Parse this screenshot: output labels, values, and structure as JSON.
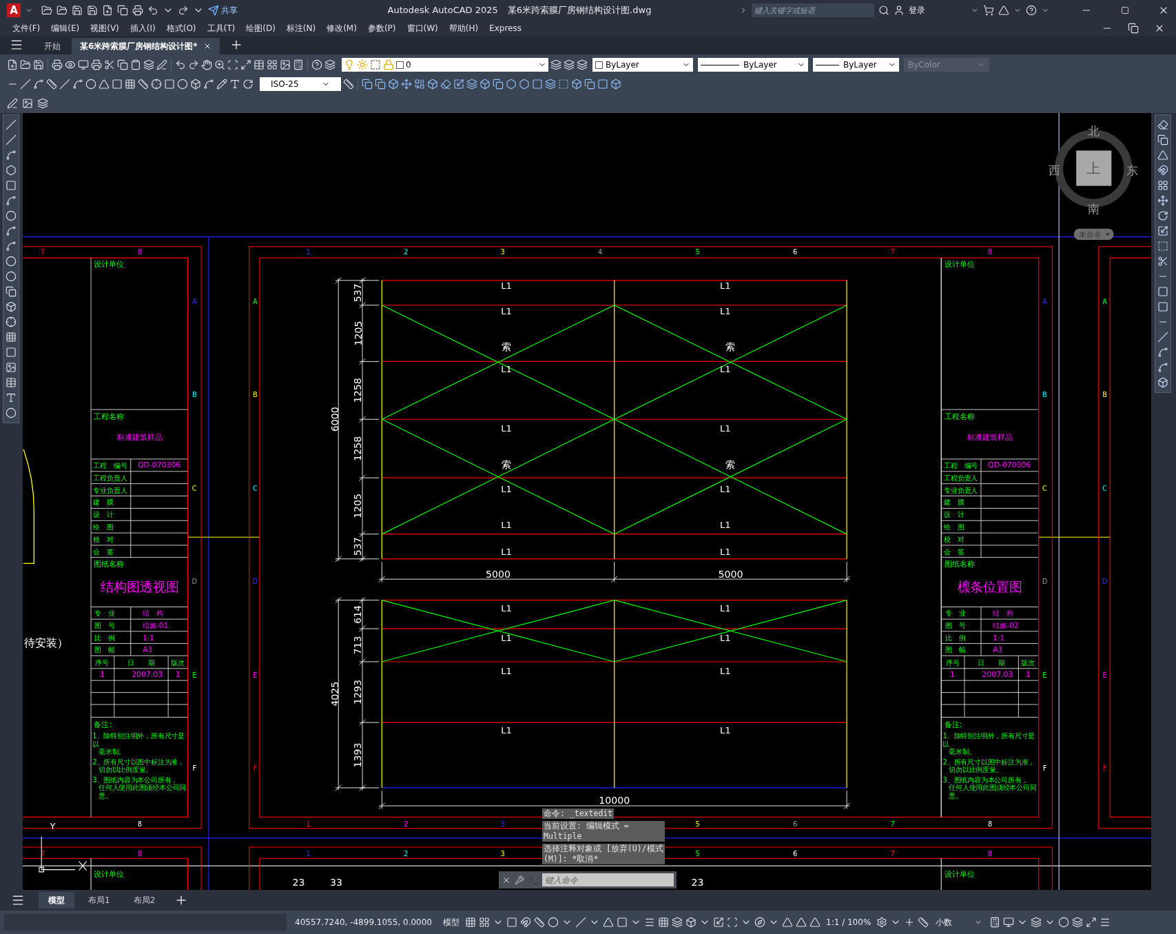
{
  "window": {
    "logo": "A",
    "title": "Autodesk AutoCAD 2025",
    "document": "某6米跨索膜厂房钢结构设计图.dwg"
  },
  "quick_access": {
    "share": "共享"
  },
  "search": {
    "placeholder": "键入关键字或短语"
  },
  "account": {
    "login": "登录"
  },
  "menu": [
    "文件(F)",
    "编辑(E)",
    "视图(V)",
    "插入(I)",
    "格式(O)",
    "工具(T)",
    "绘图(D)",
    "标注(N)",
    "修改(M)",
    "参数(P)",
    "窗口(W)",
    "帮助(H)",
    "Express"
  ],
  "file_tabs": [
    {
      "label": "开始",
      "selected": false
    },
    {
      "label": "某6米跨索膜厂房钢结构设计图*",
      "selected": true
    }
  ],
  "properties": {
    "layer": "0",
    "color_setting": "ByLayer",
    "linetype": "ByLayer",
    "lineweight": "ByLayer",
    "plot_style": {
      "label": "ByColor",
      "disabled": true
    }
  },
  "dimension_style": "ISO-25",
  "viewcube": {
    "north": "北",
    "south": "南",
    "west": "西",
    "east": "东",
    "face": "上",
    "ucs": "未命名"
  },
  "drawing": {
    "top_labels": [
      "7",
      "8",
      "1",
      "2",
      "3",
      "4",
      "5",
      "6",
      "7",
      "8"
    ],
    "bottom_labels": [
      "8",
      "1",
      "2",
      "3",
      "5",
      "6",
      "7",
      "8"
    ],
    "next_sheet_labels": [
      "7",
      "8",
      "1",
      "2",
      "3",
      "5",
      "6",
      "7",
      "8"
    ],
    "side_label_columns": [
      [
        "A",
        "B",
        "C",
        "D",
        "E",
        "F"
      ],
      [
        "A",
        "B",
        "C",
        "D",
        "E",
        "F"
      ],
      [
        "A",
        "B",
        "C",
        "D",
        "E",
        "F"
      ],
      [
        "A",
        "B",
        "C",
        "D",
        "E",
        "F"
      ]
    ],
    "title_blocks": [
      {
        "design_unit": "设计单位",
        "project_label": "工程名称",
        "project_name": "标准建筑样品",
        "staff": [
          {
            "label": "工程　编号",
            "value": "QD-070306"
          },
          {
            "label": "工程负责人"
          },
          {
            "label": "专业负责人"
          },
          {
            "label": "建　膜"
          },
          {
            "label": "设　计"
          },
          {
            "label": "绘　图"
          },
          {
            "label": "校　对"
          },
          {
            "label": "会　签"
          }
        ],
        "drawing_label": "图纸名称",
        "drawing_name": "结构图透视图",
        "details": [
          {
            "label": "专　业",
            "value": "结　构"
          },
          {
            "label": "图　号",
            "value": "结施-01"
          },
          {
            "label": "比　例",
            "value": "1:1"
          },
          {
            "label": "图　幅",
            "value": "A3"
          }
        ],
        "revision_columns": [
          "序号",
          "日　　期",
          "版次"
        ],
        "revisions": [
          {
            "number": "1",
            "date": "2007.03",
            "version": "1"
          }
        ],
        "notes_label": "备注:",
        "notes": [
          [
            "1、除特别注明外，所有尺寸是以",
            "毫米制。"
          ],
          [
            "2、所有尺寸以图中标注为准，",
            "切勿以比例度量。"
          ],
          [
            "3、图纸内容为本公司所有，",
            "任何人使用此图须经本公司同意。"
          ]
        ]
      },
      {
        "design_unit": "设计单位",
        "project_label": "工程名称",
        "project_name": "标准建筑样品",
        "staff": [
          {
            "label": "工程　编号",
            "value": "QD-070306"
          },
          {
            "label": "工程负责人"
          },
          {
            "label": "专业负责人"
          },
          {
            "label": "建　膜"
          },
          {
            "label": "设　计"
          },
          {
            "label": "绘　图"
          },
          {
            "label": "校　对"
          },
          {
            "label": "会　签"
          }
        ],
        "drawing_label": "图纸名称",
        "drawing_name": "檩条位置图",
        "details": [
          {
            "label": "专　业",
            "value": "结　构"
          },
          {
            "label": "图　号",
            "value": "结施-02"
          },
          {
            "label": "比　例",
            "value": "1:1"
          },
          {
            "label": "图　幅",
            "value": "A3"
          }
        ],
        "revision_columns": [
          "序号",
          "日　　期",
          "版次"
        ],
        "revisions": [
          {
            "number": "1",
            "date": "2007.03",
            "version": "1"
          }
        ],
        "notes_label": "备注:",
        "notes": [
          [
            "1、除特别注明外，所有尺寸是以",
            "毫米制。"
          ],
          [
            "2、所有尺寸以图中标注为准，",
            "切勿以比例度量。"
          ],
          [
            "3、图纸内容为本公司所有，",
            "任何人使用此图须经本公司同意。"
          ]
        ]
      }
    ],
    "next_sheet_units": [
      "设计单位",
      "设计单位"
    ],
    "top_plan": {
      "spans": [
        "5000",
        "5000"
      ],
      "total_depth": "6000",
      "spacings": [
        "537",
        "1205",
        "1258",
        "1258",
        "1205",
        "537"
      ],
      "purlin_labels": [
        [
          "L1",
          "L1"
        ],
        [
          "L1",
          "L1"
        ],
        [
          "L1",
          "L1"
        ],
        [
          "L1",
          "L1"
        ],
        [
          "L1",
          "L1"
        ],
        [
          "L1",
          "L1"
        ],
        [
          "L1",
          "L1"
        ]
      ],
      "cable_labels": [
        [
          "索",
          "索"
        ],
        [
          "索",
          "索"
        ]
      ]
    },
    "bottom_plan": {
      "total_span": "10000",
      "total_depth": "4025",
      "spacings": [
        "614",
        "713",
        "1293",
        "1393"
      ],
      "purlin_labels": [
        [
          "L1",
          "L1"
        ],
        [
          "L1",
          "L1"
        ],
        [
          "L1",
          "L1"
        ],
        [
          "L1",
          "L1"
        ]
      ]
    },
    "pending_note": "待安装）",
    "bottom_left_marks": [
      "23",
      "33"
    ],
    "bottom_right_mark": "23",
    "ucs_axis": "Y"
  },
  "command_line": {
    "history": [
      "命令: _textedit",
      "当前设置: 编辑模式 = Multiple",
      "选择注释对象或 [放弃(U)/模式(M)]: *取消*"
    ],
    "placeholder": "键入命令"
  },
  "layout_tabs": [
    {
      "label": "模型",
      "selected": true
    },
    {
      "label": "布局1",
      "selected": false
    },
    {
      "label": "布局2",
      "selected": false
    }
  ],
  "status_bar": {
    "coordinates": "40557.7240, -4899.1055, 0.0000",
    "space": "模型",
    "annotation_scale": "1:1 / 100%",
    "units": "小数"
  }
}
